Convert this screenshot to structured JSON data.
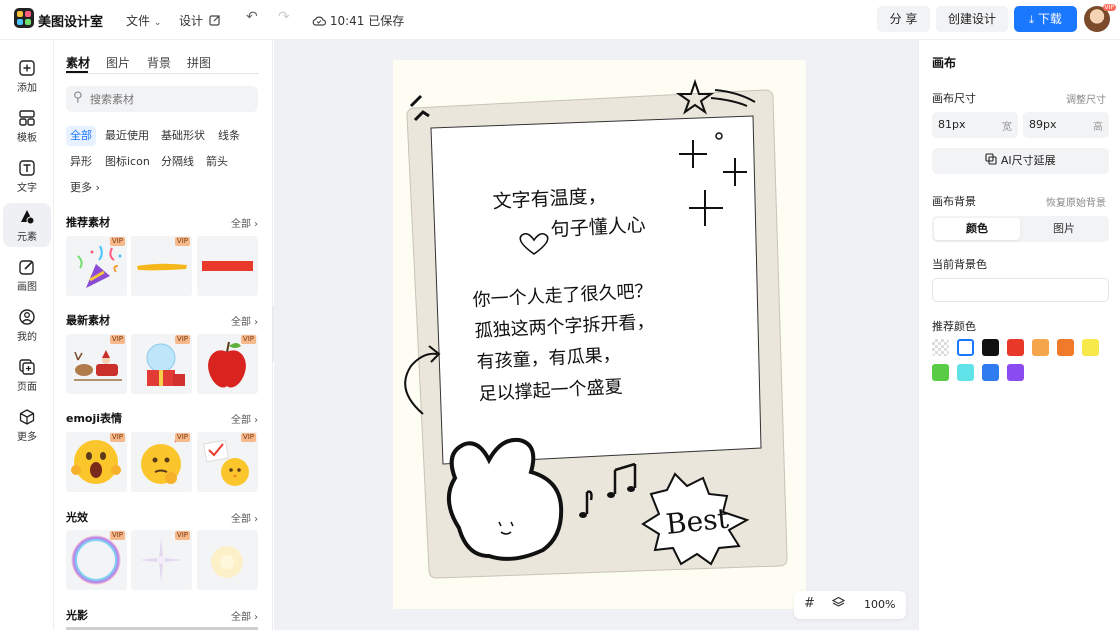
{
  "header": {
    "app_name": "美图设计室",
    "file_menu": "文件",
    "design_menu": "设计",
    "save_status": "10:41 已保存",
    "share_label": "分 享",
    "create_label": "创建设计",
    "download_label": "下载",
    "avatar_badge": "VIP"
  },
  "rail": {
    "items": [
      {
        "label": "添加",
        "icon": "plus-square-icon"
      },
      {
        "label": "模板",
        "icon": "template-icon"
      },
      {
        "label": "文字",
        "icon": "text-icon"
      },
      {
        "label": "元素",
        "icon": "shapes-icon"
      },
      {
        "label": "画图",
        "icon": "pencil-icon"
      },
      {
        "label": "我的",
        "icon": "user-icon"
      },
      {
        "label": "页面",
        "icon": "add-page-icon"
      },
      {
        "label": "更多",
        "icon": "cube-icon"
      }
    ]
  },
  "panel": {
    "tabs": [
      "素材",
      "图片",
      "背景",
      "拼图"
    ],
    "search_placeholder": "搜索素材",
    "chips": [
      "全部",
      "最近使用",
      "基础形状",
      "线条",
      "异形",
      "图标icon",
      "分隔线",
      "箭头",
      "更多"
    ],
    "vip": "VIP",
    "all_label": "全部",
    "sections": [
      {
        "title": "推荐素材"
      },
      {
        "title": "最新素材"
      },
      {
        "title": "emoji表情"
      },
      {
        "title": "光效"
      },
      {
        "title": "光影"
      }
    ]
  },
  "canvas": {
    "text_line_1": "文字有温度，",
    "text_line_2": "句子懂人心",
    "poem": [
      "你一个人走了很久吧？",
      "孤独这两个字拆开看，",
      "有孩童，有瓜果，",
      "足以撑起一个盛夏"
    ],
    "badge_text": "Best",
    "zoom": "100%"
  },
  "right_panel": {
    "title": "画布",
    "size_label": "画布尺寸",
    "adjust_size": "调整尺寸",
    "width_value": "81px",
    "width_unit": "宽",
    "height_value": "89px",
    "height_unit": "高",
    "ai_extend": "AI尺寸延展",
    "bg_label": "画布背景",
    "reset_bg": "恢复原始背景",
    "seg_color": "颜色",
    "seg_image": "图片",
    "current_bg": "当前背景色",
    "recommended": "推荐颜色",
    "swatches": [
      "transparent",
      "#ffffff",
      "#111111",
      "#e8392b",
      "#f5a54a",
      "#f07a2a",
      "#f7e94a",
      "#5acb45",
      "#5fe3e8",
      "#2f7cf0",
      "#8a4bf0"
    ]
  }
}
